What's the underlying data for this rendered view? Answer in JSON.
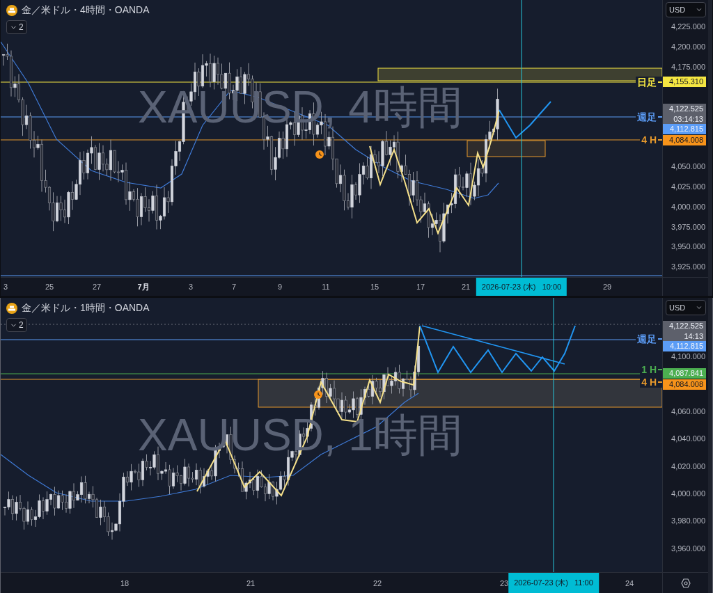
{
  "panels": [
    {
      "title": "金／米ドル・4時間・OANDA",
      "indicator_count": "2",
      "watermark": "XAUUSD, 4時間",
      "currency": "USD",
      "selected": false,
      "price_ticks": [
        "4,225.000",
        "4,200.000",
        "4,175.000",
        "4,050.000",
        "4,025.000",
        "4,000.000",
        "3,975.000",
        "3,950.000",
        "3,925.000"
      ],
      "line_labels": [
        {
          "text": "日足",
          "color": "#f5e642"
        },
        {
          "text": "週足",
          "color": "#5b9cf6"
        },
        {
          "text": "4 H",
          "color": "#e89a2c"
        }
      ],
      "price_tags": [
        {
          "price": "4,155.310",
          "color": "#f5e642"
        },
        {
          "price": "4,122.525",
          "countdown": "03:14:13",
          "color": "#5d606b"
        },
        {
          "price": "4,112.815",
          "color": "#5b9cf6"
        },
        {
          "price": "4,084.008",
          "color": "#f7931a"
        }
      ],
      "time_ticks": [
        {
          "label": "3",
          "major": false
        },
        {
          "label": "25",
          "major": false
        },
        {
          "label": "27",
          "major": false
        },
        {
          "label": "7月",
          "major": true
        },
        {
          "label": "3",
          "major": false
        },
        {
          "label": "7",
          "major": false
        },
        {
          "label": "9",
          "major": false
        },
        {
          "label": "11",
          "major": false
        },
        {
          "label": "15",
          "major": false
        },
        {
          "label": "17",
          "major": false
        },
        {
          "label": "21",
          "major": false
        },
        {
          "label": "29",
          "major": false
        }
      ],
      "crosshair_time": "2026-07-23 (木)   10:00"
    },
    {
      "title": "金／米ドル・1時間・OANDA",
      "indicator_count": "2",
      "watermark": "XAUUSD, 1時間",
      "currency": "USD",
      "selected": true,
      "price_ticks": [
        "4,100.000",
        "4,060.000",
        "4,040.000",
        "4,020.000",
        "4,000.000",
        "3,980.000",
        "3,960.000"
      ],
      "line_labels": [
        {
          "text": "週足",
          "color": "#5b9cf6"
        },
        {
          "text": "1 H",
          "color": "#4caf50"
        },
        {
          "text": "4 H",
          "color": "#e89a2c"
        }
      ],
      "price_tags": [
        {
          "price": "4,122.525",
          "countdown": "14:13",
          "color": "#5d606b"
        },
        {
          "price": "4,112.815",
          "color": "#5b9cf6"
        },
        {
          "price": "4,087.841",
          "color": "#4caf50"
        },
        {
          "price": "4,084.008",
          "color": "#f7931a"
        }
      ],
      "time_ticks": [
        {
          "label": "18",
          "major": false
        },
        {
          "label": "21",
          "major": false
        },
        {
          "label": "22",
          "major": false
        },
        {
          "label": "23",
          "major": false
        },
        {
          "label": "24",
          "major": false
        }
      ],
      "crosshair_time": "2026-07-23 (木)   11:00"
    }
  ]
}
